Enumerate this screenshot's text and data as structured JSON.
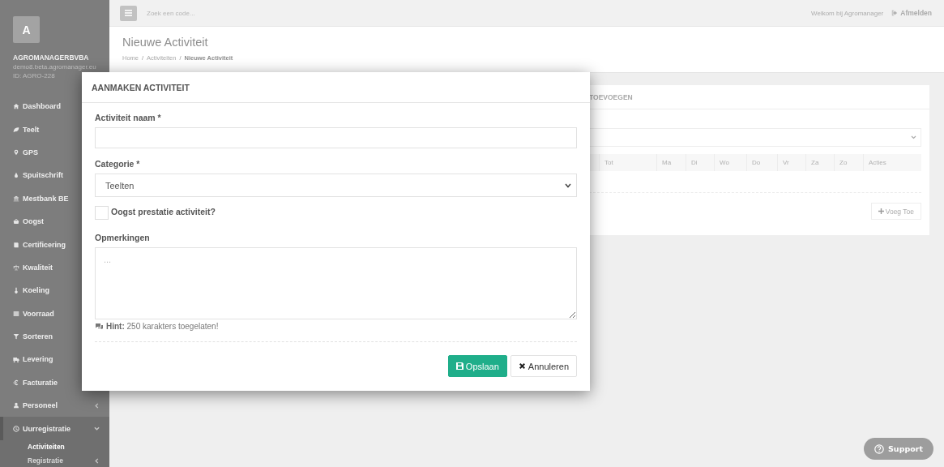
{
  "sidebar": {
    "avatar": "A",
    "company": "AGROMANAGERBVBA",
    "domain": "demo8.beta.agromanager.eu",
    "account_id": "ID: AGRO-228",
    "items": [
      {
        "label": "Dashboard",
        "selected": false
      },
      {
        "label": "Teelt",
        "selected": false
      },
      {
        "label": "GPS",
        "selected": false
      },
      {
        "label": "Spuitschrift",
        "selected": false
      },
      {
        "label": "Mestbank BE",
        "selected": false
      },
      {
        "label": "Oogst",
        "selected": false
      },
      {
        "label": "Certificering",
        "selected": false
      },
      {
        "label": "Kwaliteit",
        "selected": false
      },
      {
        "label": "Koeling",
        "selected": false
      },
      {
        "label": "Voorraad",
        "selected": false
      },
      {
        "label": "Sorteren",
        "selected": false
      },
      {
        "label": "Levering",
        "selected": false
      },
      {
        "label": "Facturatie",
        "selected": false
      },
      {
        "label": "Personeel",
        "selected": false,
        "expanded": false
      },
      {
        "label": "Uurregistratie",
        "selected": true,
        "expanded": true,
        "children": [
          {
            "label": "Activiteiten",
            "selected": true
          },
          {
            "label": "Registratie",
            "selected": false,
            "expanded": false
          }
        ]
      }
    ]
  },
  "topbar": {
    "search_placeholder": "Zoek een code...",
    "welcome": "Welkom bij Agromanager",
    "logout": "Afmelden"
  },
  "page": {
    "title": "Nieuwe Activiteit",
    "separator": "/",
    "breadcrumb": [
      {
        "label": "Home",
        "selected": false
      },
      {
        "label": "Activiteiten",
        "selected": false
      },
      {
        "label": "Nieuwe Activiteit",
        "selected": true
      }
    ]
  },
  "card": {
    "title": "TOEVOEGEN",
    "columns": [
      "Tot",
      "Ma",
      "Di",
      "Wo",
      "Do",
      "Vr",
      "Za",
      "Zo",
      "Acties"
    ],
    "add_button": "Voeg Toe"
  },
  "modal": {
    "title": "AANMAKEN ACTIVITEIT",
    "fields": [
      {
        "kind": "text",
        "label": "Activiteit naam *"
      },
      {
        "kind": "select",
        "label": "Categorie *",
        "value": "Teelten"
      },
      {
        "kind": "checkbox",
        "label": "Oogst prestatie activiteit?",
        "checked": false
      },
      {
        "kind": "textarea",
        "label": "Opmerkingen",
        "placeholder": "..."
      }
    ],
    "hint": "**Hint:** 250 karakters toegelaten!",
    "buttons": [
      {
        "kind": "primary",
        "label": "Opslaan"
      },
      {
        "kind": "default",
        "label": "Annuleren"
      }
    ]
  },
  "support": "Support"
}
